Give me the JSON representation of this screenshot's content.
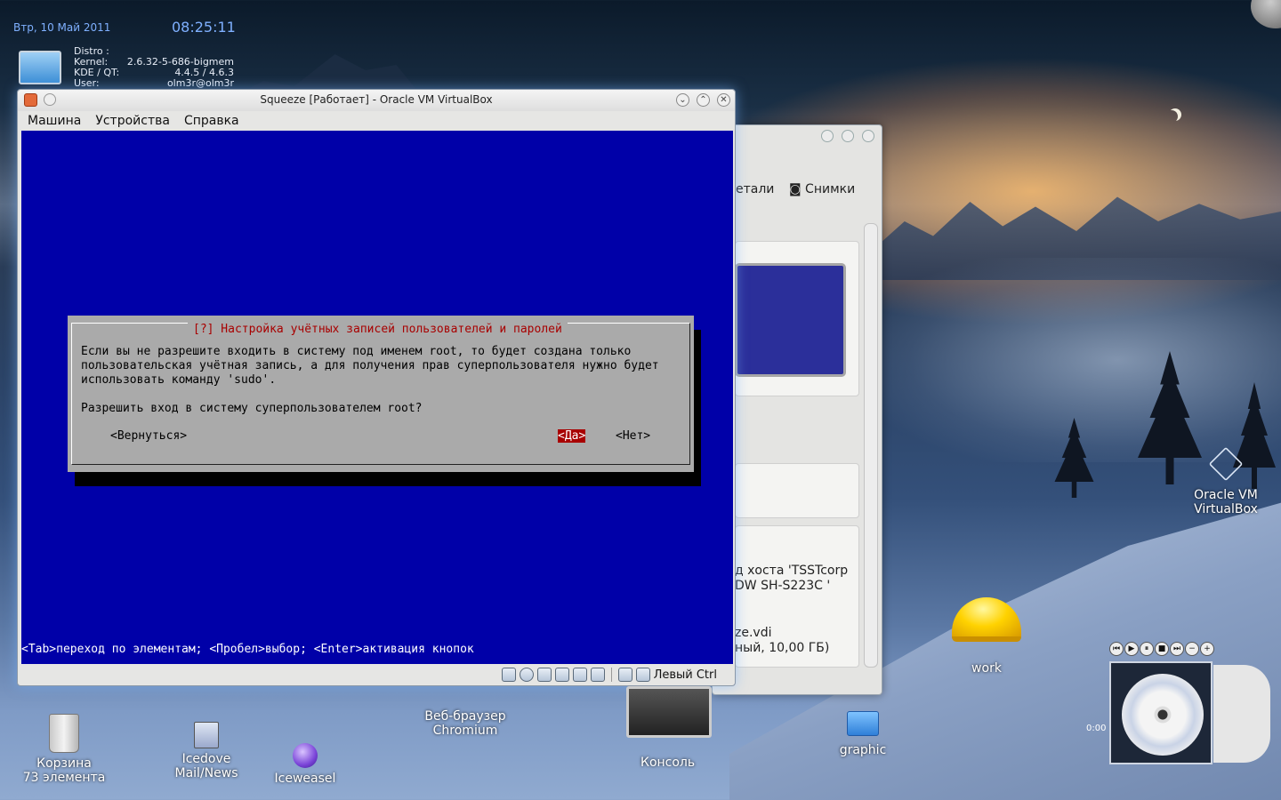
{
  "desktop": {
    "date": "Втр, 10 Май 2011",
    "time": "08:25:11",
    "sysinfo": [
      {
        "label": "Distro :",
        "value": ""
      },
      {
        "label": "Kernel:",
        "value": "2.6.32-5-686-bigmem"
      },
      {
        "label": "KDE / QT:",
        "value": "4.4.5 / 4.6.3"
      },
      {
        "label": "User:",
        "value": "olm3r@olm3r"
      }
    ],
    "icons": {
      "trash": {
        "name": "Корзина",
        "count": "73 элемента"
      },
      "icedove": {
        "line1": "Icedove",
        "line2": "Mail/News"
      },
      "iceweasel": {
        "name": "Iceweasel"
      },
      "chromium": {
        "line1": "Веб-браузер",
        "line2": "Chromium"
      },
      "console": {
        "name": "Консоль"
      },
      "graphic": {
        "name": "graphic"
      },
      "work": {
        "name": "work"
      },
      "virtualbox": {
        "line1": "Oracle VM",
        "line2": "VirtualBox"
      }
    },
    "amarok": {
      "time": "0:00",
      "controls": [
        "⏮",
        "▶",
        "⏸",
        "■",
        "⏭",
        "−",
        "+"
      ]
    }
  },
  "bg_window": {
    "tabs": [
      "етали",
      "Снимки"
    ],
    "lines": [
      "д хоста 'TSSTcorp",
      "DW SH-S223C '",
      "ze.vdi",
      "ный, 10,00 ГБ)"
    ]
  },
  "vm_window": {
    "title": "Squeeze [Работает] - Oracle VM VirtualBox",
    "menu": [
      "Машина",
      "Устройства",
      "Справка"
    ],
    "dialog": {
      "title": "[?] Настройка учётных записей пользователей и паролей",
      "body": "Если вы не разрешите входить в систему под именем root, то будет создана только\nпользовательская учётная запись, а для получения прав суперпользователя нужно будет\nиспользовать команду 'sudo'.\n\nРазрешить вход в систему суперпользователем root?",
      "back_button": "<Вернуться>",
      "yes_button": "<Да>",
      "no_button": "<Нет>"
    },
    "help_line": "<Tab>переход по элементам; <Пробел>выбор; <Enter>активация кнопок",
    "host_key": "Левый Ctrl"
  }
}
